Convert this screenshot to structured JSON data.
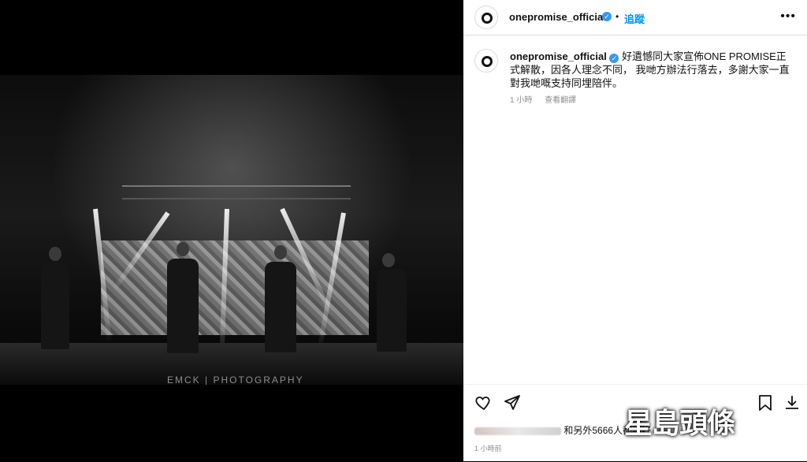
{
  "post": {
    "username": "onepromise_official",
    "follow_label": "追蹤",
    "separator": "•",
    "caption": "好遺憾同大家宣佈ONE PROMISE正式解散，因各人理念不同， 我哋方辦法行落去，多謝大家一直對我哋嘅支持同埋陪伴。",
    "caption_time": "1 小時",
    "translate_label": "查看翻譯",
    "likes_suffix": "和另外5666人都讚好",
    "post_time": "1 小時前"
  },
  "photo": {
    "watermark": "EMCK | PHOTOGRAPHY"
  },
  "overlay": {
    "logo_text": "星島頭條"
  },
  "icons": {
    "more": "more-options-icon",
    "verified": "verified-badge-icon",
    "like": "heart-icon",
    "share": "send-icon",
    "save": "bookmark-icon",
    "download": "download-icon"
  },
  "colors": {
    "accent": "#0095f6",
    "verified": "#3897f0",
    "muted": "#8e8e8e"
  }
}
